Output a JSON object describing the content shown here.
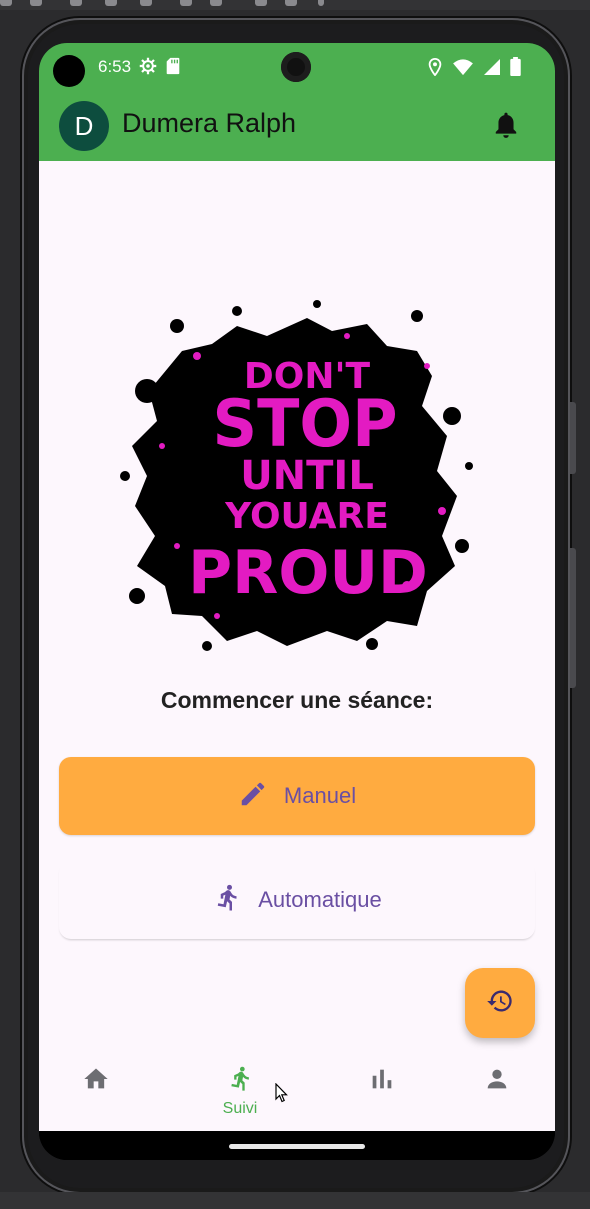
{
  "status_bar": {
    "time": "6:53",
    "left_icons": [
      "settings-icon",
      "sd-card-icon"
    ],
    "right_icons": [
      "location-icon",
      "wifi-icon",
      "signal-icon",
      "battery-icon"
    ]
  },
  "app_bar": {
    "avatar_letter": "D",
    "user_name": "Dumera Ralph",
    "notification_icon": "bell-icon"
  },
  "main": {
    "poster_text": [
      "DON'T",
      "STOP",
      "UNTIL",
      "YOUARE",
      "PROUD"
    ],
    "section_title": "Commencer une séance:",
    "buttons": {
      "manual": {
        "label": "Manuel",
        "icon": "pencil-icon"
      },
      "automatic": {
        "label": "Automatique",
        "icon": "running-icon"
      }
    },
    "fab_icon": "history-icon"
  },
  "bottom_nav": {
    "items": [
      {
        "icon": "home-icon",
        "label": "",
        "active": false
      },
      {
        "icon": "running-icon",
        "label": "Suivi",
        "active": true
      },
      {
        "icon": "bar-chart-icon",
        "label": "",
        "active": false
      },
      {
        "icon": "person-icon",
        "label": "",
        "active": false
      }
    ]
  },
  "colors": {
    "primary_green": "#4caf50",
    "accent_orange": "#ffab40",
    "button_text_purple": "#6a4fa3",
    "poster_magenta": "#e31bc2",
    "background": "#fdf7fd"
  }
}
